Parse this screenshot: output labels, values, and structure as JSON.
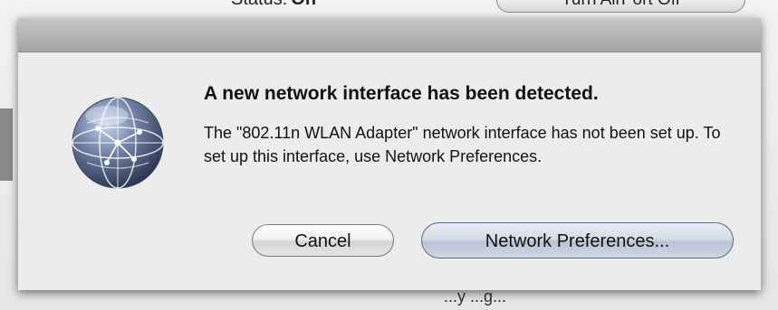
{
  "background": {
    "status_label": "Status:",
    "status_value": "On",
    "airport_button_label": "Turn AirPort Off",
    "bottom_text": "...y ...g..."
  },
  "dialog": {
    "icon": "network-globe-icon",
    "title": "A new network interface has been detected.",
    "message": "The \"802.11n WLAN Adapter\" network interface has not been set up. To set up this interface, use Network Preferences.",
    "buttons": {
      "cancel": "Cancel",
      "network_preferences": "Network Preferences..."
    }
  },
  "colors": {
    "dialog_bg": "#ececec",
    "titlebar": "#b4b4b4",
    "default_button": "#c9d1de"
  }
}
